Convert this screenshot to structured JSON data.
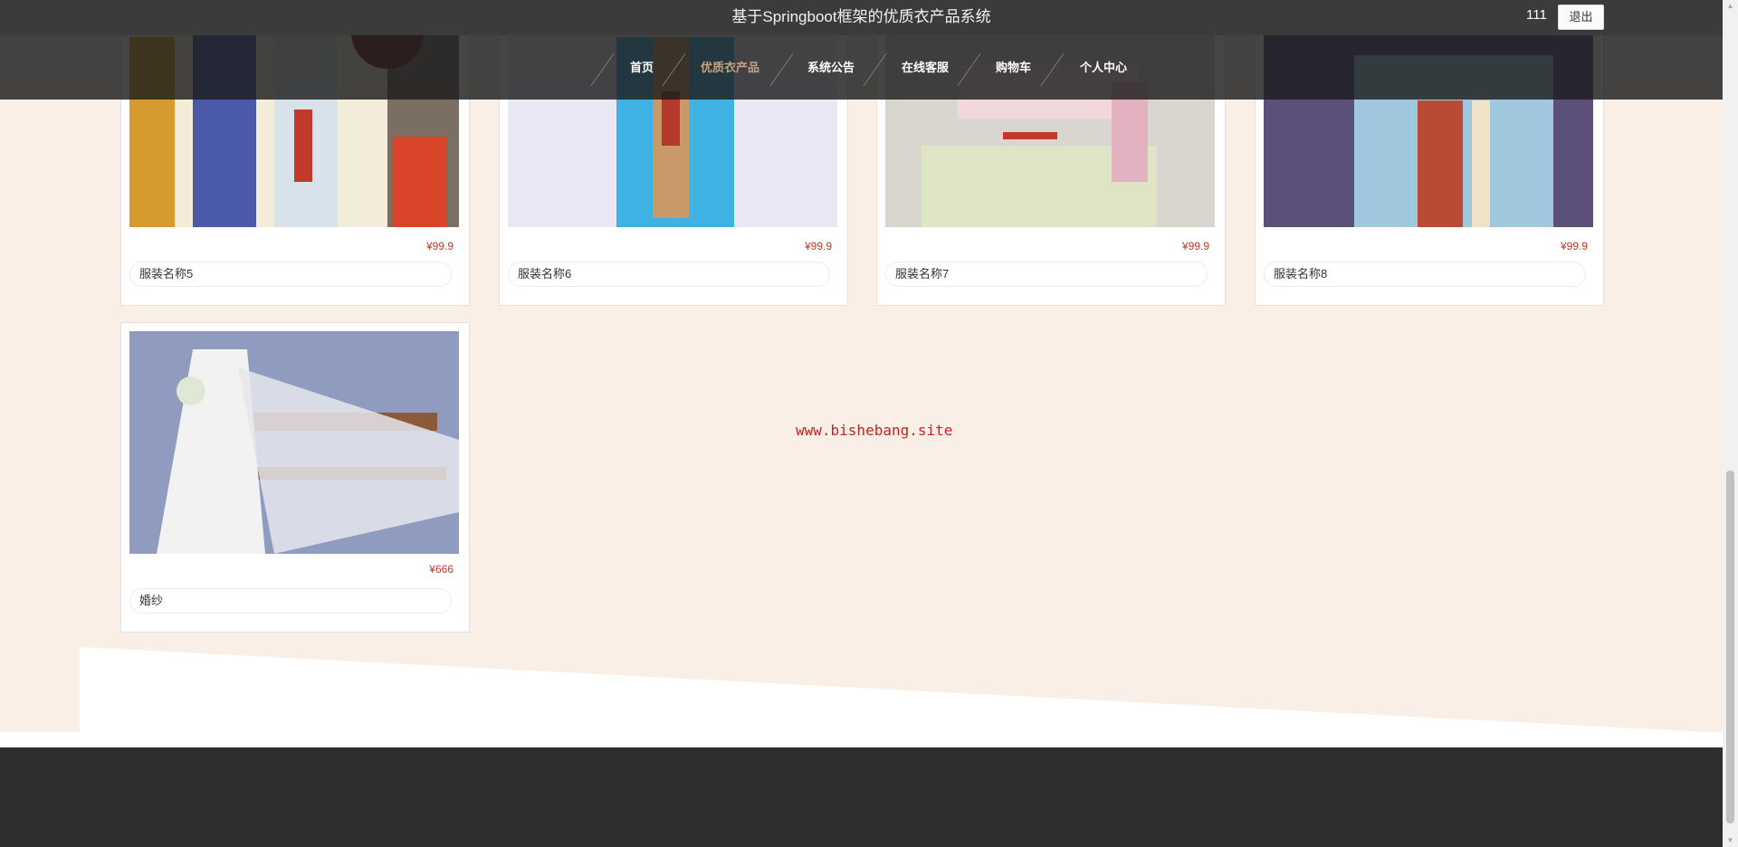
{
  "header": {
    "title": "基于Springboot框架的优质衣产品系统",
    "username": "111",
    "logout_label": "退出"
  },
  "nav": {
    "items": [
      {
        "label": "首页",
        "active": false
      },
      {
        "label": "优质衣产品",
        "active": true
      },
      {
        "label": "系统公告",
        "active": false
      },
      {
        "label": "在线客服",
        "active": false
      },
      {
        "label": "购物车",
        "active": false
      },
      {
        "label": "个人中心",
        "active": false
      }
    ]
  },
  "products": [
    {
      "name": "服装名称5",
      "price": "¥99.9"
    },
    {
      "name": "服装名称6",
      "price": "¥99.9"
    },
    {
      "name": "服装名称7",
      "price": "¥99.9"
    },
    {
      "name": "服装名称8",
      "price": "¥99.9"
    },
    {
      "name": "婚纱",
      "price": "¥666"
    }
  ],
  "watermark": "www.bishebang.site",
  "colors": {
    "accent": "#c9a27c",
    "price": "#c0392b",
    "page_bg": "#f9efe6"
  }
}
